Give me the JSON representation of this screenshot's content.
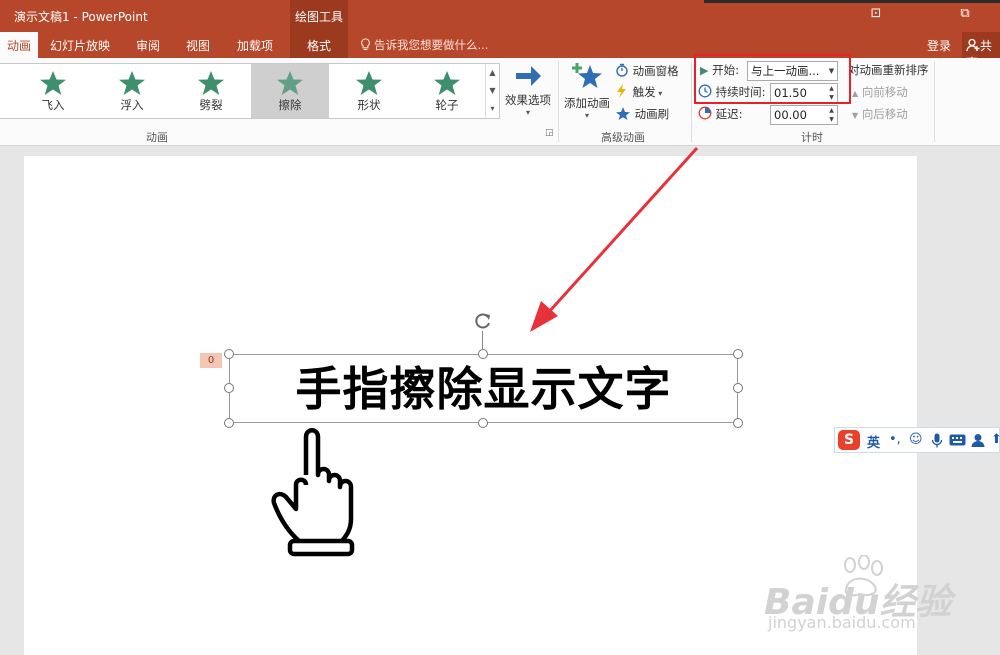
{
  "titlebar": {
    "doc_title": "演示文稿1 - PowerPoint",
    "context_tool": "绘图工具",
    "btn_restore": "⧉",
    "btn_ribbon": "⊡"
  },
  "tabs": {
    "animation": "动画",
    "slideshow": "幻灯片放映",
    "review": "审阅",
    "view": "视图",
    "addins": "加载项",
    "format": "格式",
    "tellme": "告诉我您想要做什么...",
    "login": "登录",
    "share": "共享"
  },
  "gallery": {
    "items": [
      "飞入",
      "浮入",
      "劈裂",
      "擦除",
      "形状",
      "轮子"
    ],
    "selected": "擦除",
    "star_color": "#3d8f6e"
  },
  "effect_options": {
    "label": "效果选项"
  },
  "group_animation": {
    "label": "动画"
  },
  "advanced": {
    "add_animation": "添加动画",
    "pane": "动画窗格",
    "trigger": "触发",
    "painter": "动画刷",
    "group_label": "高级动画"
  },
  "timing": {
    "start_label": "开始:",
    "start_value": "与上一动画...",
    "duration_label": "持续时间:",
    "duration_value": "01.50",
    "delay_label": "延迟:",
    "delay_value": "00.00",
    "reorder": "对动画重新排序",
    "move_earlier": "向前移动",
    "move_later": "向后移动",
    "group_label": "计时"
  },
  "slide": {
    "text": "手指擦除显示文字",
    "anim_tag": "0"
  },
  "ime": {
    "mode": "英",
    "punct": "•,",
    "logo": "S"
  },
  "watermark": {
    "brand": "Baidu经验",
    "url": "jingyan.baidu.com"
  },
  "colors": {
    "ppt_accent": "#b7472a",
    "highlight_box": "#e8202a",
    "arrow": "#e8323a"
  }
}
